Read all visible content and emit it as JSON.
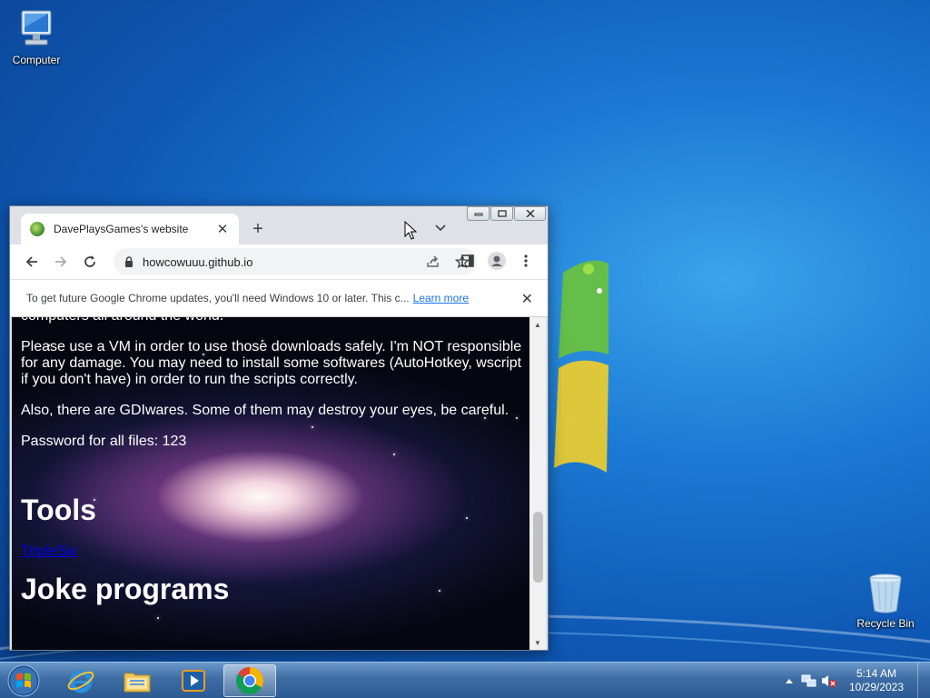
{
  "desktop": {
    "icons": [
      {
        "label": "Computer",
        "icon": "computer-icon"
      },
      {
        "label": "Recycle Bin",
        "icon": "recycle-bin-icon"
      }
    ]
  },
  "browser": {
    "tab": {
      "title": "DavePlaysGames's website",
      "icon": "site-favicon"
    },
    "address": "howcowuuu.github.io",
    "infobar": {
      "message": "To get future Google Chrome updates, you'll need Windows 10 or later. This c...",
      "link": "Learn more"
    },
    "page": {
      "para_top": "computers all around the world.",
      "para_vm": "Please use a VM in order to use those downloads safely. I'm NOT responsible for any damage. You may need to install some softwares (AutoHotkey, wscript if you don't have) in order to run the scripts correctly.",
      "para_gdi": "Also, there are GDIwares. Some of them may destroy your eyes, be careful.",
      "para_password": "Password for all files: 123",
      "heading_tools": "Tools",
      "link_triplesix": "TripleSix",
      "heading_joke": "Joke programs"
    }
  },
  "taskbar": {
    "apps": [
      {
        "name": "internet-explorer-icon"
      },
      {
        "name": "file-explorer-icon"
      },
      {
        "name": "media-player-icon"
      },
      {
        "name": "chrome-icon",
        "active": true
      }
    ],
    "clock": {
      "time": "5:14 AM",
      "date": "10/29/2023"
    }
  },
  "colors": {
    "desktop_blue": "#1c7ad4",
    "link_blue": "#1a73e8",
    "page_link": "#0000ee"
  }
}
